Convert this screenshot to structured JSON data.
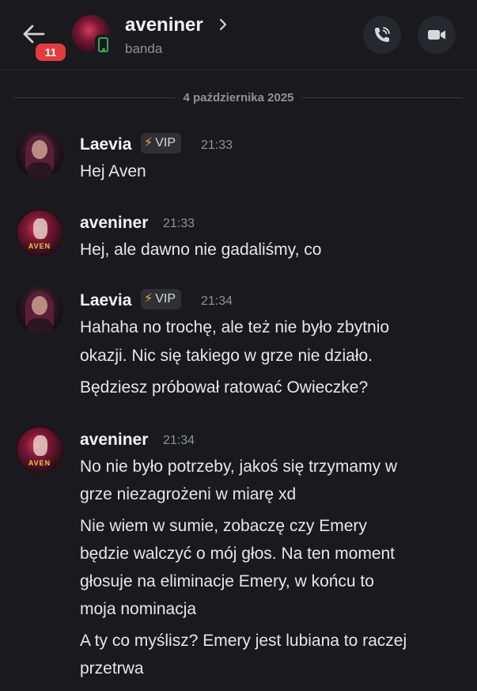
{
  "header": {
    "back_badge": "11",
    "channel_name": "aveniner",
    "status": "banda"
  },
  "divider": {
    "date": "4 października 2025"
  },
  "messages": [
    {
      "author": "Laevia",
      "badge": "VIP",
      "time": "21:33",
      "lines": [
        "Hej Aven"
      ]
    },
    {
      "author": "aveniner",
      "time": "21:33",
      "lines": [
        "Hej, ale dawno nie gadaliśmy, co"
      ]
    },
    {
      "author": "Laevia",
      "badge": "VIP",
      "time": "21:34",
      "lines": [
        "Hahaha no trochę, ale też nie było zbytnio",
        "okazji. Nic się takiego w grze nie działo.",
        "Będziesz próbował ratować Owieczke?"
      ]
    },
    {
      "author": "aveniner",
      "time": "21:34",
      "lines": [
        "No nie było potrzeby, jakoś się trzymamy w",
        "grze niezagrożeni w miarę xd",
        "Nie wiem w sumie, zobaczę czy Emery",
        "będzie walczyć o mój głos. Na ten moment",
        "głosuje na eliminacje Emery, w końcu to",
        "moja nominacja",
        "A ty co myślisz? Emery jest lubiana to raczej",
        "przetrwa"
      ]
    }
  ],
  "avatar_labels": {
    "aven": "AVEN"
  },
  "icons": {
    "back": "arrow-left-icon",
    "phone_status": "mobile-phone-icon",
    "chevron": "chevron-right-icon",
    "call": "phone-call-icon",
    "video": "video-camera-icon",
    "vip": "lightning-bolt-icon"
  },
  "colors": {
    "background": "#1a1a1e",
    "badge_red": "#e23c3f",
    "online_green": "#3ba55d",
    "muted_text": "#8e9297",
    "vip_bolt": "#f0b132"
  }
}
